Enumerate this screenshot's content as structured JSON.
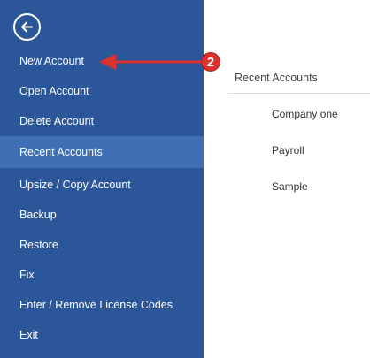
{
  "sidebar": {
    "back_icon": "back-arrow-icon",
    "items": [
      {
        "label": "New Account"
      },
      {
        "label": "Open Account"
      },
      {
        "label": "Delete Account"
      },
      {
        "label": "Recent Accounts",
        "selected": true
      },
      {
        "label": "Upsize / Copy Account"
      },
      {
        "label": "Backup"
      },
      {
        "label": "Restore"
      },
      {
        "label": "Fix"
      },
      {
        "label": "Enter / Remove License Codes"
      },
      {
        "label": "Exit"
      }
    ]
  },
  "content": {
    "section_title": "Recent Accounts",
    "recent_accounts": [
      {
        "label": "Company one"
      },
      {
        "label": "Payroll"
      },
      {
        "label": "Sample"
      }
    ]
  },
  "annotation": {
    "badge_number": "2",
    "color": "#d9322f"
  },
  "colors": {
    "sidebar_bg": "#2b579a",
    "selected_bg": "#3f6fb5"
  }
}
